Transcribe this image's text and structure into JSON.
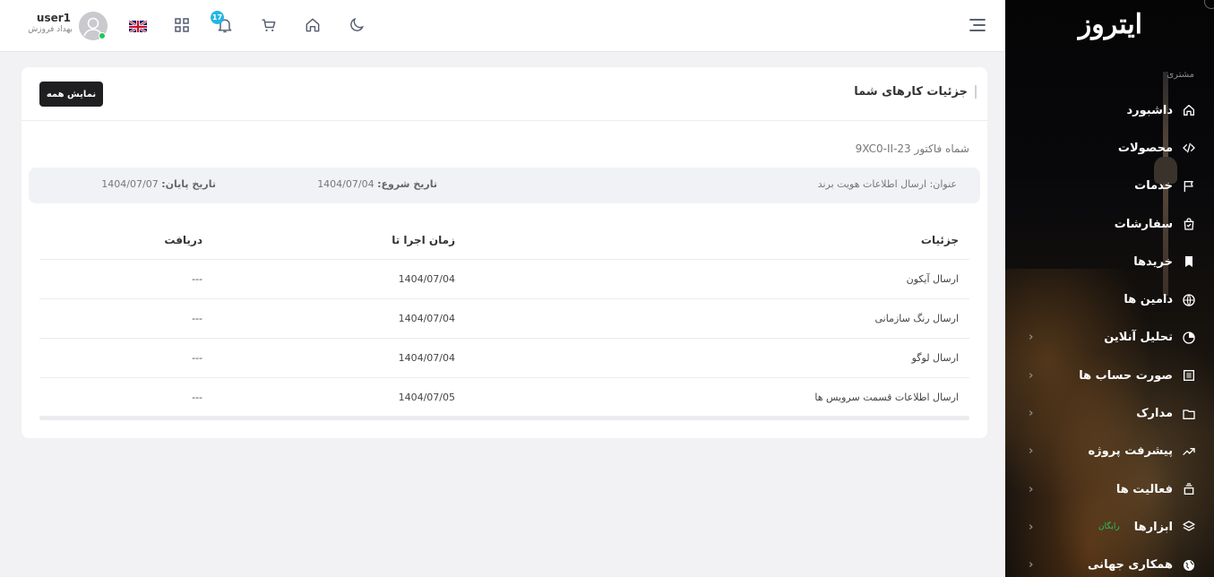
{
  "sidebar": {
    "logo": "ایتروز",
    "section_label": "مشتری",
    "items": [
      {
        "label": "داشبورد",
        "icon": "home-icon",
        "chevron": false
      },
      {
        "label": "محصولات",
        "icon": "code-icon",
        "chevron": false
      },
      {
        "label": "خدمات",
        "icon": "flag-icon",
        "chevron": false
      },
      {
        "label": "سفارشات",
        "icon": "shopping-bag-icon",
        "chevron": false
      },
      {
        "label": "خریدها",
        "icon": "bookmark-icon",
        "chevron": false
      },
      {
        "label": "دامین ها",
        "icon": "globe-icon",
        "chevron": false
      },
      {
        "label": "تحلیل آنلاین",
        "icon": "pie-chart-icon",
        "chevron": true
      },
      {
        "label": "صورت حساب ها",
        "icon": "invoice-icon",
        "chevron": true
      },
      {
        "label": "مدارک",
        "icon": "folder-icon",
        "chevron": true
      },
      {
        "label": "پیشرفت پروژه",
        "icon": "trending-up-icon",
        "chevron": true
      },
      {
        "label": "فعالیت ها",
        "icon": "stack-icon",
        "chevron": true
      },
      {
        "label": "ابزارها",
        "icon": "layers-icon",
        "chevron": true,
        "badge": "رایگان"
      },
      {
        "label": "همکاری جهانی",
        "icon": "world-icon",
        "chevron": true
      }
    ]
  },
  "topbar": {
    "user_name": "user1",
    "user_subtitle": "بهداد فروزش",
    "notification_count": "17",
    "language": "English"
  },
  "card": {
    "title": "جزئیات کارهای شما",
    "show_all_label": "نمایش همه",
    "invoice_label": "شماه فاکتور 23-9XC0-II",
    "info": {
      "title_label": "عنوان:",
      "title_value": "ارسال اطلاعات هویت برند",
      "start_label": "تاریخ شروع:",
      "start_value": "1404/07/04",
      "end_label": "تاریخ پایان:",
      "end_value": "1404/07/07"
    },
    "table": {
      "headers": [
        "جزئیات",
        "زمان اجرا تا",
        "دریافت"
      ],
      "rows": [
        [
          "ارسال آیکون",
          "1404/07/04",
          "---"
        ],
        [
          "ارسال رنگ سازمانی",
          "1404/07/04",
          "---"
        ],
        [
          "ارسال لوگو",
          "1404/07/04",
          "---"
        ],
        [
          "ارسال اطلاعات قسمت سرویس ها",
          "1404/07/05",
          "---"
        ]
      ]
    }
  },
  "colors": {
    "accent_badge": "#26b5e6",
    "online": "#22c55e",
    "button_dark": "#1f1f22"
  }
}
